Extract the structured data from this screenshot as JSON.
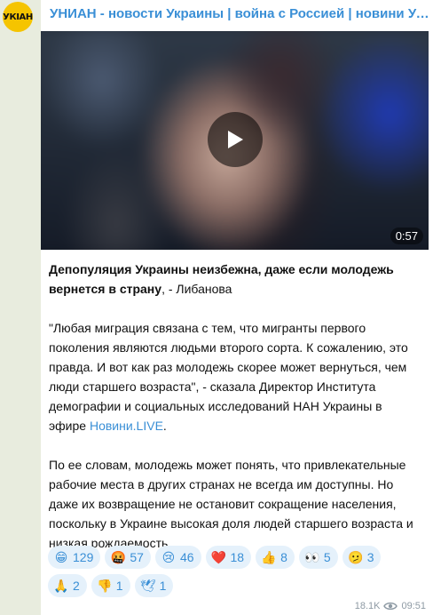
{
  "channel": {
    "avatar_text": "УКІАН",
    "name": "УНИАН - новости Украины | война с Россией | новини Україні..."
  },
  "video": {
    "duration": "0:57",
    "play_icon": "play-icon"
  },
  "post": {
    "headline_bold": "Депопуляция Украины неизбежна, даже если молодежь вернется в страну",
    "headline_rest": ", - Либанова",
    "para1": "\"Любая миграция связана с тем, что мигранты первого поколения являются людьми второго сорта. К сожалению, это правда. И вот как раз молодежь скорее может вернуться, чем люди старшего возраста\", - сказала Директор Института демографии и социальных исследований НАН Украины в эфире ",
    "link": "Новини.LIVE",
    "para1_end": ".",
    "para2": "По ее словам, молодежь может понять, что привлекательные рабочие места в других странах не всегда им доступны. Но даже их возвращение не остановит сокращение населения, поскольку в Украине высокая доля людей старшего возраста и низкая рождаемость."
  },
  "reactions": [
    {
      "emoji": "😁",
      "count": "129"
    },
    {
      "emoji": "🤬",
      "count": "57"
    },
    {
      "emoji": "😢",
      "count": "46"
    },
    {
      "emoji": "❤️",
      "count": "18"
    },
    {
      "emoji": "👍",
      "count": "8"
    },
    {
      "emoji": "👀",
      "count": "5"
    },
    {
      "emoji": "🫤",
      "count": "3"
    },
    {
      "emoji": "🙏",
      "count": "2"
    },
    {
      "emoji": "👎",
      "count": "1"
    },
    {
      "emoji": "🕊",
      "count": "1"
    }
  ],
  "meta": {
    "views": "18.1K",
    "time": "09:51"
  },
  "colors": {
    "accent": "#3a8fd6",
    "background": "#e8ecde",
    "avatar": "#f5c400"
  }
}
